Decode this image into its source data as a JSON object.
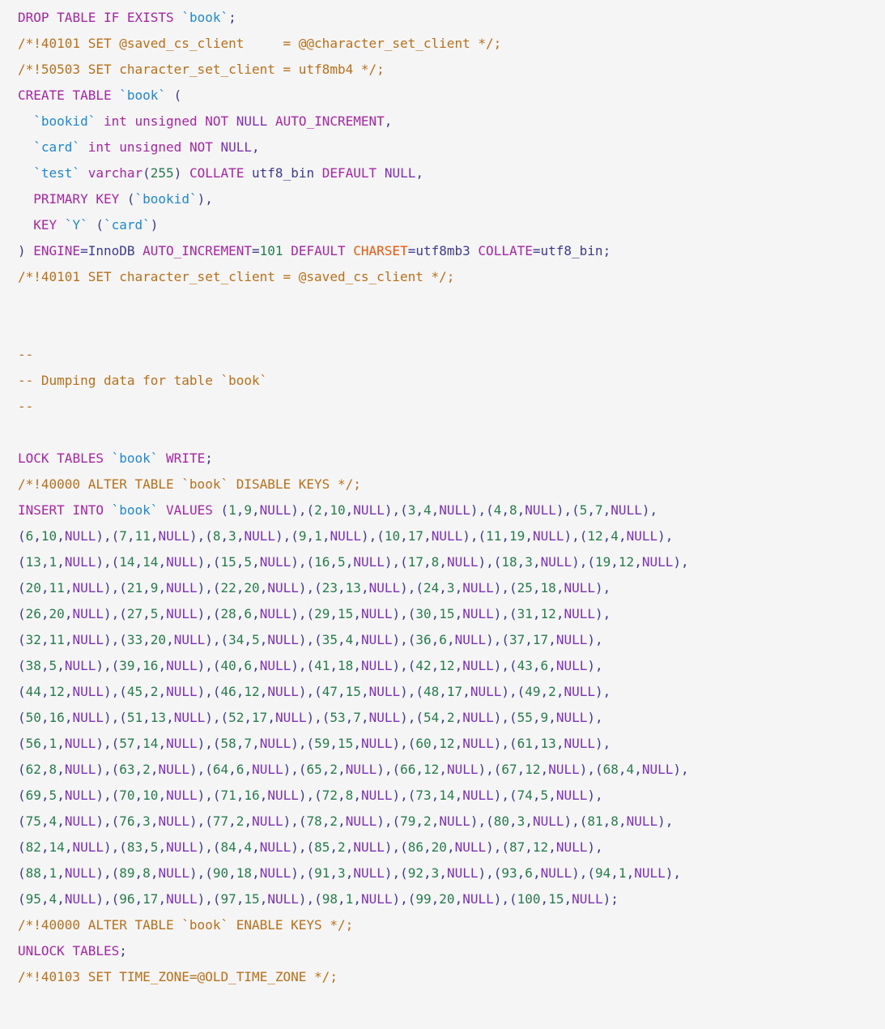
{
  "document": {
    "kind": "sql-dump",
    "title": "MySQL dump for table `book`",
    "background_color": "#f5f5f5",
    "font_size_px": 16,
    "line_height_px": 32
  },
  "colors": {
    "keyword": "#a626a4",
    "identifier": "#1e88d4",
    "comment": "#b8701a",
    "number": "#267c4e",
    "punctuation": "#3b3b8f",
    "charset": "#e8590c",
    "null_literal": "#7b2fbe",
    "background": "#f5f5f5"
  },
  "schema": {
    "table_name": "book",
    "engine": "InnoDB",
    "auto_increment": "101",
    "default_charset": "utf8mb3",
    "collate": "utf8_bin",
    "columns": [
      {
        "name": "bookid",
        "type": "int unsigned",
        "attrs": "NOT NULL AUTO_INCREMENT"
      },
      {
        "name": "card",
        "type": "int unsigned",
        "attrs": "NOT NULL"
      },
      {
        "name": "test",
        "type": "varchar(255)",
        "attrs": "COLLATE utf8_bin DEFAULT NULL"
      }
    ],
    "primary_key": "bookid",
    "keys": [
      {
        "name": "Y",
        "column": "card"
      }
    ]
  },
  "lines": [
    {
      "id": "l01",
      "text": "DROP TABLE IF EXISTS `book`;"
    },
    {
      "id": "l02",
      "text": "/*!40101 SET @saved_cs_client     = @@character_set_client */;"
    },
    {
      "id": "l03",
      "text": "/*!50503 SET character_set_client = utf8mb4 */;"
    },
    {
      "id": "l04",
      "text": "CREATE TABLE `book` ("
    },
    {
      "id": "l05",
      "text": "  `bookid` int unsigned NOT NULL AUTO_INCREMENT,"
    },
    {
      "id": "l06",
      "text": "  `card` int unsigned NOT NULL,"
    },
    {
      "id": "l07",
      "text": "  `test` varchar(255) COLLATE utf8_bin DEFAULT NULL,"
    },
    {
      "id": "l08",
      "text": "  PRIMARY KEY (`bookid`),"
    },
    {
      "id": "l09",
      "text": "  KEY `Y` (`card`)"
    },
    {
      "id": "l10",
      "text": ") ENGINE=InnoDB AUTO_INCREMENT=101 DEFAULT CHARSET=utf8mb3 COLLATE=utf8_bin;"
    },
    {
      "id": "l11",
      "text": "/*!40101 SET character_set_client = @saved_cs_client */;"
    },
    {
      "id": "l12",
      "text": ""
    },
    {
      "id": "l13",
      "text": ""
    },
    {
      "id": "l14",
      "text": "--"
    },
    {
      "id": "l15",
      "text": "-- Dumping data for table `book`"
    },
    {
      "id": "l16",
      "text": "--"
    },
    {
      "id": "l17",
      "text": ""
    },
    {
      "id": "l18",
      "text": "LOCK TABLES `book` WRITE;"
    },
    {
      "id": "l19",
      "text": "/*!40000 ALTER TABLE `book` DISABLE KEYS */;"
    },
    {
      "id": "l20",
      "text": "INSERT INTO `book` VALUES (1,9,NULL),(2,10,NULL),(3,4,NULL),(4,8,NULL),(5,7,NULL),"
    },
    {
      "id": "l21",
      "text": "(6,10,NULL),(7,11,NULL),(8,3,NULL),(9,1,NULL),(10,17,NULL),(11,19,NULL),(12,4,NULL),"
    },
    {
      "id": "l22",
      "text": "(13,1,NULL),(14,14,NULL),(15,5,NULL),(16,5,NULL),(17,8,NULL),(18,3,NULL),(19,12,NULL),"
    },
    {
      "id": "l23",
      "text": "(20,11,NULL),(21,9,NULL),(22,20,NULL),(23,13,NULL),(24,3,NULL),(25,18,NULL),"
    },
    {
      "id": "l24",
      "text": "(26,20,NULL),(27,5,NULL),(28,6,NULL),(29,15,NULL),(30,15,NULL),(31,12,NULL),"
    },
    {
      "id": "l25",
      "text": "(32,11,NULL),(33,20,NULL),(34,5,NULL),(35,4,NULL),(36,6,NULL),(37,17,NULL),"
    },
    {
      "id": "l26",
      "text": "(38,5,NULL),(39,16,NULL),(40,6,NULL),(41,18,NULL),(42,12,NULL),(43,6,NULL),"
    },
    {
      "id": "l27",
      "text": "(44,12,NULL),(45,2,NULL),(46,12,NULL),(47,15,NULL),(48,17,NULL),(49,2,NULL),"
    },
    {
      "id": "l28",
      "text": "(50,16,NULL),(51,13,NULL),(52,17,NULL),(53,7,NULL),(54,2,NULL),(55,9,NULL),"
    },
    {
      "id": "l29",
      "text": "(56,1,NULL),(57,14,NULL),(58,7,NULL),(59,15,NULL),(60,12,NULL),(61,13,NULL),"
    },
    {
      "id": "l30",
      "text": "(62,8,NULL),(63,2,NULL),(64,6,NULL),(65,2,NULL),(66,12,NULL),(67,12,NULL),(68,4,NULL),"
    },
    {
      "id": "l31",
      "text": "(69,5,NULL),(70,10,NULL),(71,16,NULL),(72,8,NULL),(73,14,NULL),(74,5,NULL),"
    },
    {
      "id": "l32",
      "text": "(75,4,NULL),(76,3,NULL),(77,2,NULL),(78,2,NULL),(79,2,NULL),(80,3,NULL),(81,8,NULL),"
    },
    {
      "id": "l33",
      "text": "(82,14,NULL),(83,5,NULL),(84,4,NULL),(85,2,NULL),(86,20,NULL),(87,12,NULL),"
    },
    {
      "id": "l34",
      "text": "(88,1,NULL),(89,8,NULL),(90,18,NULL),(91,3,NULL),(92,3,NULL),(93,6,NULL),(94,1,NULL),"
    },
    {
      "id": "l35",
      "text": "(95,4,NULL),(96,17,NULL),(97,15,NULL),(98,1,NULL),(99,20,NULL),(100,15,NULL);"
    },
    {
      "id": "l36",
      "text": "/*!40000 ALTER TABLE `book` ENABLE KEYS */;"
    },
    {
      "id": "l37",
      "text": "UNLOCK TABLES;"
    },
    {
      "id": "l38",
      "text": "/*!40103 SET TIME_ZONE=@OLD_TIME_ZONE */;"
    }
  ],
  "inserted_rows": [
    [
      1,
      9,
      "NULL"
    ],
    [
      2,
      10,
      "NULL"
    ],
    [
      3,
      4,
      "NULL"
    ],
    [
      4,
      8,
      "NULL"
    ],
    [
      5,
      7,
      "NULL"
    ],
    [
      6,
      10,
      "NULL"
    ],
    [
      7,
      11,
      "NULL"
    ],
    [
      8,
      3,
      "NULL"
    ],
    [
      9,
      1,
      "NULL"
    ],
    [
      10,
      17,
      "NULL"
    ],
    [
      11,
      19,
      "NULL"
    ],
    [
      12,
      4,
      "NULL"
    ],
    [
      13,
      1,
      "NULL"
    ],
    [
      14,
      14,
      "NULL"
    ],
    [
      15,
      5,
      "NULL"
    ],
    [
      16,
      5,
      "NULL"
    ],
    [
      17,
      8,
      "NULL"
    ],
    [
      18,
      3,
      "NULL"
    ],
    [
      19,
      12,
      "NULL"
    ],
    [
      20,
      11,
      "NULL"
    ],
    [
      21,
      9,
      "NULL"
    ],
    [
      22,
      20,
      "NULL"
    ],
    [
      23,
      13,
      "NULL"
    ],
    [
      24,
      3,
      "NULL"
    ],
    [
      25,
      18,
      "NULL"
    ],
    [
      26,
      20,
      "NULL"
    ],
    [
      27,
      5,
      "NULL"
    ],
    [
      28,
      6,
      "NULL"
    ],
    [
      29,
      15,
      "NULL"
    ],
    [
      30,
      15,
      "NULL"
    ],
    [
      31,
      12,
      "NULL"
    ],
    [
      32,
      11,
      "NULL"
    ],
    [
      33,
      20,
      "NULL"
    ],
    [
      34,
      5,
      "NULL"
    ],
    [
      35,
      4,
      "NULL"
    ],
    [
      36,
      6,
      "NULL"
    ],
    [
      37,
      17,
      "NULL"
    ],
    [
      38,
      5,
      "NULL"
    ],
    [
      39,
      16,
      "NULL"
    ],
    [
      40,
      6,
      "NULL"
    ],
    [
      41,
      18,
      "NULL"
    ],
    [
      42,
      12,
      "NULL"
    ],
    [
      43,
      6,
      "NULL"
    ],
    [
      44,
      12,
      "NULL"
    ],
    [
      45,
      2,
      "NULL"
    ],
    [
      46,
      12,
      "NULL"
    ],
    [
      47,
      15,
      "NULL"
    ],
    [
      48,
      17,
      "NULL"
    ],
    [
      49,
      2,
      "NULL"
    ],
    [
      50,
      16,
      "NULL"
    ],
    [
      51,
      13,
      "NULL"
    ],
    [
      52,
      17,
      "NULL"
    ],
    [
      53,
      7,
      "NULL"
    ],
    [
      54,
      2,
      "NULL"
    ],
    [
      55,
      9,
      "NULL"
    ],
    [
      56,
      1,
      "NULL"
    ],
    [
      57,
      14,
      "NULL"
    ],
    [
      58,
      7,
      "NULL"
    ],
    [
      59,
      15,
      "NULL"
    ],
    [
      60,
      12,
      "NULL"
    ],
    [
      61,
      13,
      "NULL"
    ],
    [
      62,
      8,
      "NULL"
    ],
    [
      63,
      2,
      "NULL"
    ],
    [
      64,
      6,
      "NULL"
    ],
    [
      65,
      2,
      "NULL"
    ],
    [
      66,
      12,
      "NULL"
    ],
    [
      67,
      12,
      "NULL"
    ],
    [
      68,
      4,
      "NULL"
    ],
    [
      69,
      5,
      "NULL"
    ],
    [
      70,
      10,
      "NULL"
    ],
    [
      71,
      16,
      "NULL"
    ],
    [
      72,
      8,
      "NULL"
    ],
    [
      73,
      14,
      "NULL"
    ],
    [
      74,
      5,
      "NULL"
    ],
    [
      75,
      4,
      "NULL"
    ],
    [
      76,
      3,
      "NULL"
    ],
    [
      77,
      2,
      "NULL"
    ],
    [
      78,
      2,
      "NULL"
    ],
    [
      79,
      2,
      "NULL"
    ],
    [
      80,
      3,
      "NULL"
    ],
    [
      81,
      8,
      "NULL"
    ],
    [
      82,
      14,
      "NULL"
    ],
    [
      83,
      5,
      "NULL"
    ],
    [
      84,
      4,
      "NULL"
    ],
    [
      85,
      2,
      "NULL"
    ],
    [
      86,
      20,
      "NULL"
    ],
    [
      87,
      12,
      "NULL"
    ],
    [
      88,
      1,
      "NULL"
    ],
    [
      89,
      8,
      "NULL"
    ],
    [
      90,
      18,
      "NULL"
    ],
    [
      91,
      3,
      "NULL"
    ],
    [
      92,
      3,
      "NULL"
    ],
    [
      93,
      6,
      "NULL"
    ],
    [
      94,
      1,
      "NULL"
    ],
    [
      95,
      4,
      "NULL"
    ],
    [
      96,
      17,
      "NULL"
    ],
    [
      97,
      15,
      "NULL"
    ],
    [
      98,
      1,
      "NULL"
    ],
    [
      99,
      20,
      "NULL"
    ],
    [
      100,
      15,
      "NULL"
    ]
  ]
}
